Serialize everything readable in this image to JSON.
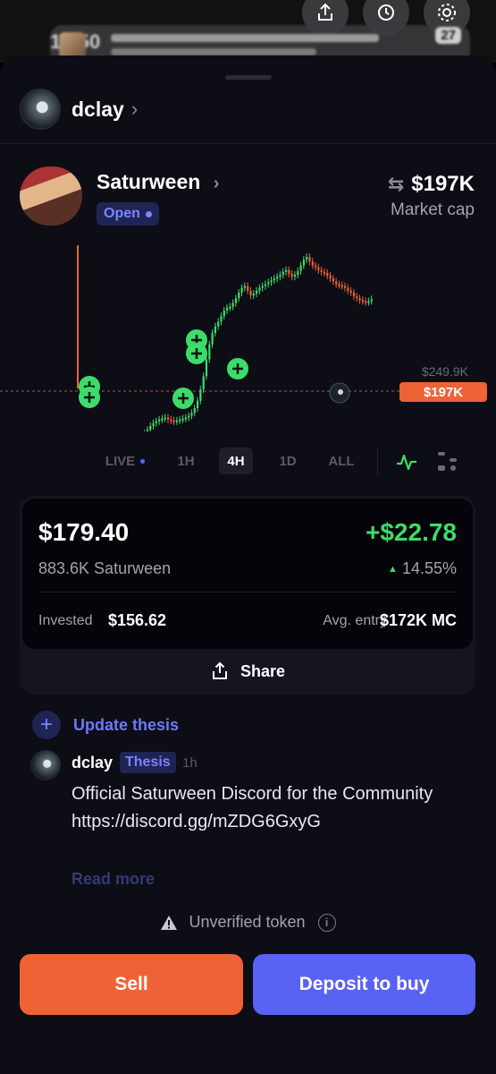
{
  "status": {
    "time": "12:50",
    "notification_badge": "27"
  },
  "creator": {
    "name": "dclay",
    "chevron": "›"
  },
  "token": {
    "name": "Saturween",
    "chevron": "›",
    "status": "Open",
    "market_cap": "$197K",
    "market_cap_label": "Market cap"
  },
  "chart_data": {
    "type": "line",
    "title": "",
    "price_labels": {
      "high": "$249.9K",
      "current": "$197K"
    },
    "accent_colors": {
      "up": "#3ddc6a",
      "down": "#ef6235"
    },
    "candles": [
      [
        220,
        6
      ],
      [
        160,
        8
      ],
      [
        120,
        12
      ],
      [
        100,
        11
      ],
      [
        70,
        10
      ],
      [
        60,
        12
      ],
      [
        45,
        11
      ],
      [
        50,
        13
      ],
      [
        58,
        14
      ],
      [
        64,
        14
      ],
      [
        70,
        16
      ],
      [
        74,
        17
      ],
      [
        80,
        18
      ],
      [
        88,
        18
      ],
      [
        95,
        17
      ],
      [
        100,
        19
      ],
      [
        108,
        20
      ],
      [
        114,
        22
      ],
      [
        120,
        22
      ],
      [
        126,
        24
      ],
      [
        132,
        25
      ],
      [
        142,
        27
      ],
      [
        156,
        31
      ],
      [
        170,
        35
      ],
      [
        182,
        39
      ],
      [
        190,
        42
      ],
      [
        198,
        44
      ],
      [
        202,
        46
      ],
      [
        208,
        47
      ],
      [
        212,
        48
      ],
      [
        216,
        46
      ],
      [
        220,
        45
      ],
      [
        222,
        44
      ],
      [
        224,
        45
      ],
      [
        226,
        46
      ],
      [
        228,
        47
      ],
      [
        230,
        48
      ],
      [
        232,
        50
      ],
      [
        234,
        53
      ],
      [
        236,
        58
      ],
      [
        238,
        66
      ],
      [
        240,
        78
      ],
      [
        242,
        92
      ],
      [
        244,
        110
      ],
      [
        246,
        126
      ],
      [
        248,
        138
      ],
      [
        250,
        145
      ],
      [
        252,
        150
      ],
      [
        254,
        156
      ],
      [
        256,
        162
      ],
      [
        258,
        165
      ],
      [
        260,
        166
      ],
      [
        262,
        170
      ],
      [
        264,
        175
      ],
      [
        266,
        181
      ],
      [
        268,
        186
      ],
      [
        270,
        188
      ],
      [
        272,
        183
      ],
      [
        274,
        178
      ],
      [
        276,
        180
      ],
      [
        278,
        183
      ],
      [
        280,
        186
      ],
      [
        282,
        188
      ],
      [
        284,
        190
      ],
      [
        286,
        192
      ],
      [
        288,
        194
      ],
      [
        290,
        196
      ],
      [
        292,
        198
      ],
      [
        294,
        200
      ],
      [
        296,
        203
      ],
      [
        298,
        205
      ],
      [
        300,
        201
      ],
      [
        302,
        198
      ],
      [
        304,
        200
      ],
      [
        306,
        204
      ],
      [
        308,
        210
      ],
      [
        310,
        216
      ],
      [
        312,
        219
      ],
      [
        314,
        214
      ],
      [
        316,
        210
      ],
      [
        318,
        208
      ],
      [
        320,
        205
      ],
      [
        322,
        203
      ],
      [
        324,
        202
      ],
      [
        326,
        199
      ],
      [
        328,
        196
      ],
      [
        330,
        193
      ],
      [
        332,
        190
      ],
      [
        334,
        189
      ],
      [
        336,
        188
      ],
      [
        338,
        186
      ],
      [
        340,
        183
      ],
      [
        342,
        181
      ],
      [
        344,
        177
      ],
      [
        346,
        175
      ],
      [
        348,
        173
      ],
      [
        350,
        172
      ],
      [
        352,
        171
      ],
      [
        354,
        172
      ],
      [
        356,
        174
      ]
    ]
  },
  "timeframes": [
    {
      "label": "LIVE",
      "active": false,
      "live": true
    },
    {
      "label": "1H",
      "active": false
    },
    {
      "label": "4H",
      "active": true
    },
    {
      "label": "1D",
      "active": false
    },
    {
      "label": "ALL",
      "active": false
    }
  ],
  "position": {
    "value": "$179.40",
    "pnl": "+$22.78",
    "quantity": "883.6K Saturween",
    "pnl_pct": "14.55%",
    "invested_label": "Invested",
    "invested_value": "$156.62",
    "avg_entry_label": "Avg. entry",
    "avg_entry_value": "$172K MC",
    "share_label": "Share"
  },
  "thesis": {
    "update_label": "Update thesis",
    "author": "dclay",
    "badge": "Thesis",
    "time": "1h",
    "body": "Official Saturween Discord for the Community https://discord.gg/mZDG6GxyG",
    "read_more": "Read more"
  },
  "footer": {
    "unverified_label": "Unverified token",
    "sell_label": "Sell",
    "buy_label": "Deposit to buy"
  }
}
